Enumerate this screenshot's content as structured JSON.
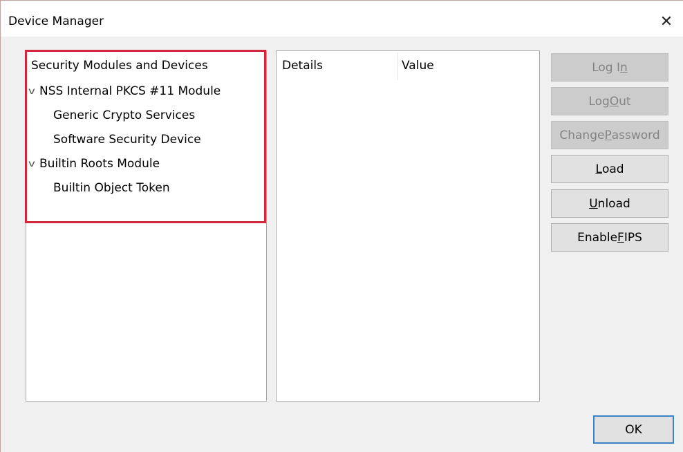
{
  "window": {
    "title": "Device Manager",
    "close_glyph": "✕"
  },
  "tree": {
    "header": "Security Modules and Devices",
    "modules": [
      {
        "label": "NSS Internal PKCS #11 Module",
        "expanded": true,
        "children": [
          "Generic Crypto Services",
          "Software Security Device"
        ]
      },
      {
        "label": "Builtin Roots Module",
        "expanded": true,
        "children": [
          "Builtin Object Token"
        ]
      }
    ],
    "chevron_glyph": "v"
  },
  "details": {
    "columns": [
      "Details",
      "Value"
    ]
  },
  "buttons": {
    "login": {
      "pre": "Log I",
      "key": "n",
      "post": "",
      "enabled": false
    },
    "logout": {
      "pre": "Log ",
      "key": "O",
      "post": "ut",
      "enabled": false
    },
    "change_password": {
      "pre": "Change ",
      "key": "P",
      "post": "assword",
      "enabled": false
    },
    "load": {
      "pre": "",
      "key": "L",
      "post": "oad",
      "enabled": true
    },
    "unload": {
      "pre": "",
      "key": "U",
      "post": "nload",
      "enabled": true
    },
    "enable_fips": {
      "pre": "Enable ",
      "key": "F",
      "post": "IPS",
      "enabled": true
    },
    "ok": "OK"
  },
  "colors": {
    "highlight_border": "#d0283a",
    "ok_focus_border": "#3c80c8"
  }
}
